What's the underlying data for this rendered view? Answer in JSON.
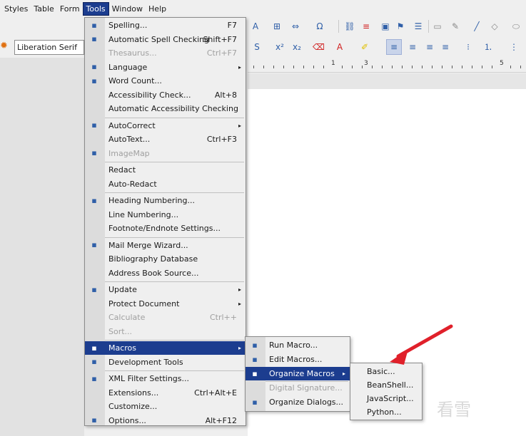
{
  "menubar": {
    "items": [
      "Styles",
      "Table",
      "Form",
      "Tools",
      "Window",
      "Help"
    ]
  },
  "toolbar": {
    "font_name": "Liberation Serif"
  },
  "ruler": {
    "labels": [
      "1",
      "3",
      "5"
    ]
  },
  "tools_menu": {
    "items": [
      {
        "label": "Spelling...",
        "shortcut": "F7",
        "icon": "spelling-icon"
      },
      {
        "label": "Automatic Spell Checking",
        "shortcut": "Shift+F7",
        "icon": "auto-spell-icon"
      },
      {
        "label": "Thesaurus...",
        "shortcut": "Ctrl+F7",
        "disabled": true
      },
      {
        "label": "Language",
        "submenu": true,
        "icon": "language-icon"
      },
      {
        "label": "Word Count...",
        "icon": "word-count-icon"
      },
      {
        "label": "Accessibility Check...",
        "shortcut": "Alt+8"
      },
      {
        "label": "Automatic Accessibility Checking"
      },
      {
        "label": "AutoCorrect",
        "submenu": true,
        "icon": "autocorrect-icon"
      },
      {
        "label": "AutoText...",
        "shortcut": "Ctrl+F3"
      },
      {
        "label": "ImageMap",
        "disabled": true,
        "icon": "imagemap-icon"
      },
      {
        "label": "Redact"
      },
      {
        "label": "Auto-Redact"
      },
      {
        "label": "Heading Numbering...",
        "icon": "heading-numbering-icon"
      },
      {
        "label": "Line Numbering..."
      },
      {
        "label": "Footnote/Endnote Settings..."
      },
      {
        "label": "Mail Merge Wizard...",
        "icon": "mail-merge-icon"
      },
      {
        "label": "Bibliography Database"
      },
      {
        "label": "Address Book Source..."
      },
      {
        "label": "Update",
        "submenu": true,
        "icon": "update-icon"
      },
      {
        "label": "Protect Document",
        "submenu": true
      },
      {
        "label": "Calculate",
        "shortcut": "Ctrl++",
        "disabled": true
      },
      {
        "label": "Sort...",
        "disabled": true
      },
      {
        "label": "Macros",
        "submenu": true,
        "selected": true,
        "icon": "macros-icon"
      },
      {
        "label": "Development Tools",
        "icon": "development-tools-icon"
      },
      {
        "label": "XML Filter Settings...",
        "icon": "xml-filter-icon"
      },
      {
        "label": "Extensions...",
        "shortcut": "Ctrl+Alt+E"
      },
      {
        "label": "Customize..."
      },
      {
        "label": "Options...",
        "shortcut": "Alt+F12",
        "icon": "options-gear-icon"
      }
    ]
  },
  "macros_menu": {
    "items": [
      {
        "label": "Run Macro...",
        "icon": "run-macro-icon"
      },
      {
        "label": "Edit Macros...",
        "icon": "edit-macros-icon"
      },
      {
        "label": "Organize Macros",
        "submenu": true,
        "selected": true,
        "icon": "organize-macros-icon"
      },
      {
        "label": "Digital Signature...",
        "disabled": true
      },
      {
        "label": "Organize Dialogs...",
        "icon": "organize-dialogs-icon"
      }
    ]
  },
  "organize_menu": {
    "items": [
      {
        "label": "Basic..."
      },
      {
        "label": "BeanShell..."
      },
      {
        "label": "JavaScript..."
      },
      {
        "label": "Python..."
      }
    ]
  },
  "annotation": {
    "arrow_color": "#e0202a"
  },
  "colors": {
    "menu_highlight": "#1c3d8f",
    "menu_bg": "#efefef",
    "disabled_text": "#a0a0a0"
  },
  "watermark": {
    "text": "看雪"
  }
}
